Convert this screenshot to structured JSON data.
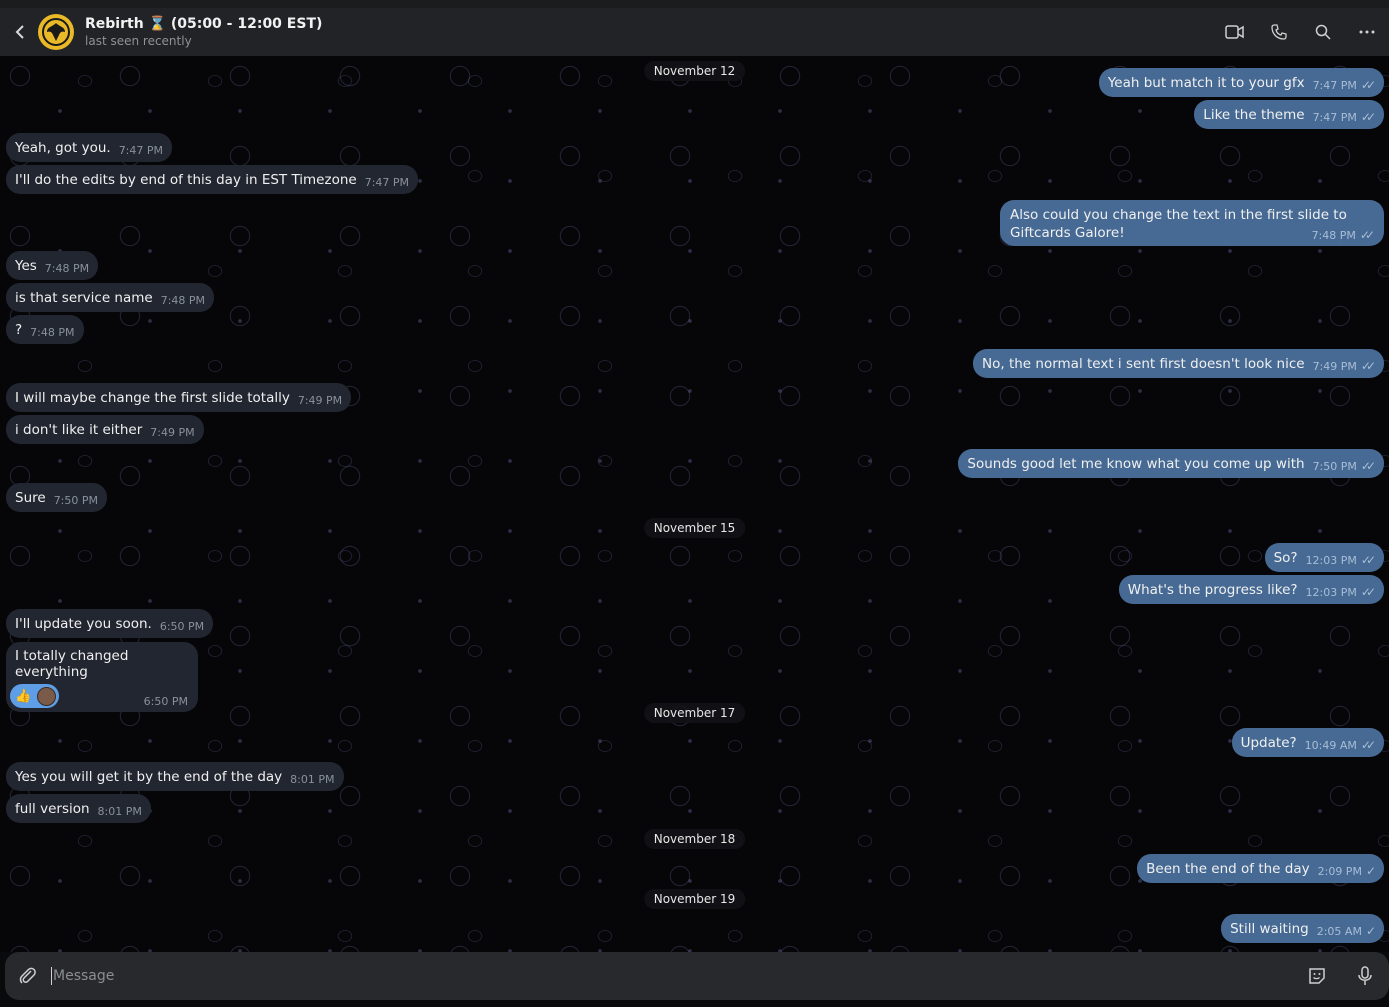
{
  "header": {
    "title": "Rebirth ⌛ (05:00 - 12:00 EST)",
    "status": "last seen recently",
    "icons": [
      "back-arrow-icon",
      "video-call-icon",
      "phone-icon",
      "search-icon",
      "more-icon"
    ]
  },
  "colors": {
    "incoming_bubble": "#212630",
    "outgoing_bubble": "#466a94",
    "avatar": "#e9b928"
  },
  "dates": [
    "November 12",
    "November 15",
    "November 17",
    "November 18",
    "November 19"
  ],
  "messages": [
    {
      "dir": "out",
      "text": "Yeah but match it to your gfx",
      "time": "7:47 PM",
      "status": "read"
    },
    {
      "dir": "out",
      "text": "Like the theme",
      "time": "7:47 PM",
      "status": "read"
    },
    {
      "dir": "in",
      "text": "Yeah, got you.",
      "time": "7:47 PM"
    },
    {
      "dir": "in",
      "text": "I'll do the edits by end of this day in EST Timezone",
      "time": "7:47 PM"
    },
    {
      "dir": "out",
      "text": "Also could you change the text in the first slide to Giftcards Galore!",
      "time": "7:48 PM",
      "status": "read"
    },
    {
      "dir": "in",
      "text": "Yes",
      "time": "7:48 PM"
    },
    {
      "dir": "in",
      "text": "is that service name",
      "time": "7:48 PM"
    },
    {
      "dir": "in",
      "text": "?",
      "time": "7:48 PM"
    },
    {
      "dir": "out",
      "text": "No, the normal text i sent first doesn't look nice",
      "time": "7:49 PM",
      "status": "read"
    },
    {
      "dir": "in",
      "text": "I will maybe change the first slide totally",
      "time": "7:49 PM"
    },
    {
      "dir": "in",
      "text": "i don't like it either",
      "time": "7:49 PM"
    },
    {
      "dir": "out",
      "text": "Sounds good let me know what you come up with",
      "time": "7:50 PM",
      "status": "read"
    },
    {
      "dir": "in",
      "text": "Sure",
      "time": "7:50 PM"
    },
    {
      "dir": "out",
      "text": "So?",
      "time": "12:03 PM",
      "status": "read"
    },
    {
      "dir": "out",
      "text": "What's the progress like?",
      "time": "12:03 PM",
      "status": "read"
    },
    {
      "dir": "in",
      "text": "I'll update you soon.",
      "time": "6:50 PM"
    },
    {
      "dir": "in",
      "text": "I totally changed everything",
      "time": "6:50 PM",
      "reaction": "👍"
    },
    {
      "dir": "out",
      "text": "Update?",
      "time": "10:49 AM",
      "status": "read"
    },
    {
      "dir": "in",
      "text": "Yes you will get it by the end of the day",
      "time": "8:01 PM"
    },
    {
      "dir": "in",
      "text": "full version",
      "time": "8:01 PM"
    },
    {
      "dir": "out",
      "text": "Been the end of the day",
      "time": "2:09 PM",
      "status": "sent"
    },
    {
      "dir": "out",
      "text": "Still waiting",
      "time": "2:05 AM",
      "status": "sent"
    }
  ],
  "check_read": "✓✓",
  "check_sent": "✓",
  "composer": {
    "placeholder": "Message"
  }
}
